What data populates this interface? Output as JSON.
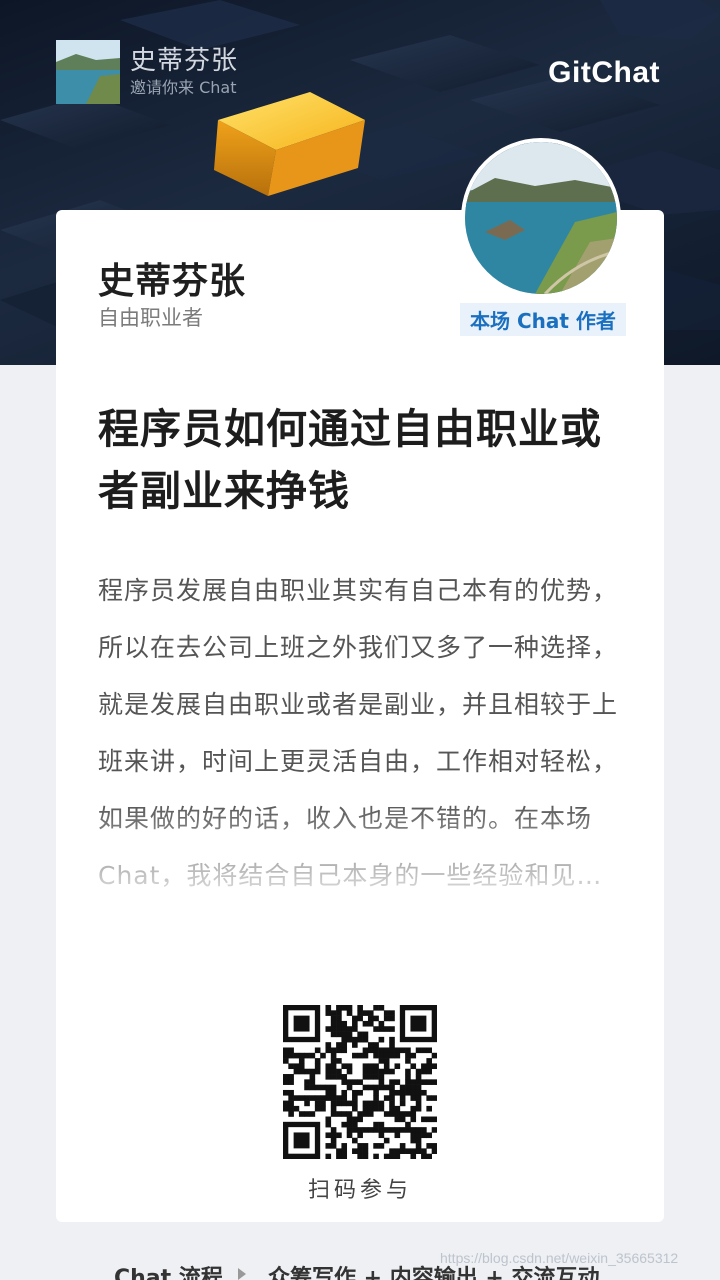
{
  "header": {
    "inviter_name": "史蒂芬张",
    "inviter_subtitle": "邀请你来 Chat",
    "brand": "GitChat"
  },
  "author": {
    "name": "史蒂芬张",
    "role": "自由职业者",
    "badge": "本场 Chat 作者"
  },
  "chat": {
    "title": "程序员如何通过自由职业或者副业来挣钱",
    "description": "程序员发展自由职业其实有自己本有的优势，所以在去公司上班之外我们又多了一种选择，就是发展自由职业或者是副业，并且相较于上班来讲，时间上更灵活自由，工作相对轻松，如果做的好的话，收入也是不错的。在本场 Chat，我将结合自己本身的一些经验和见…"
  },
  "qr": {
    "caption": "扫码参与"
  },
  "footer": {
    "label": "Chat 流程",
    "steps": "众筹写作 + 内容输出 + 交流互动"
  },
  "watermark": "https://blog.csdn.net/weixin_35665312",
  "icons": {
    "arrow": "triangle-right-icon"
  },
  "colors": {
    "banner": "#162235",
    "badge_text": "#1b6fbf",
    "badge_bg": "#e9f2fb",
    "page_bg": "#eef0f3"
  }
}
